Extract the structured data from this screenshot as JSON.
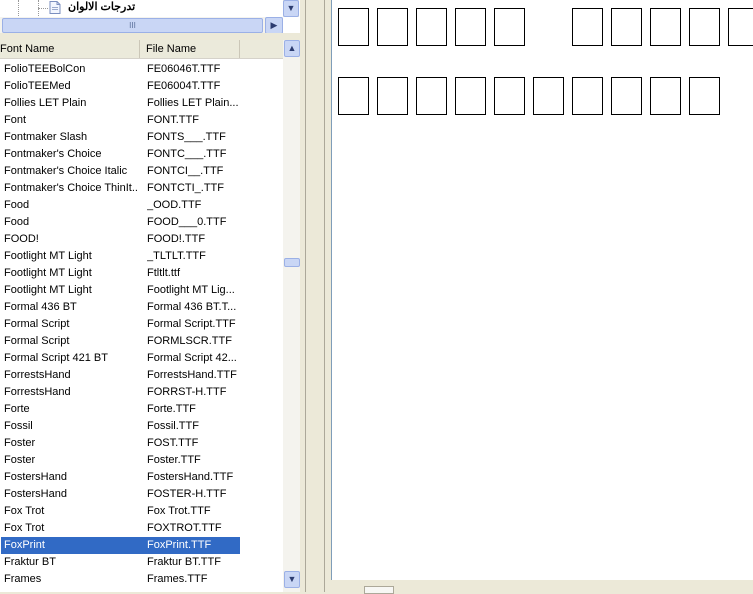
{
  "tree": {
    "label": "تدرجات الالوان"
  },
  "list": {
    "columns": {
      "font_name": "Font Name",
      "file_name": "File Name"
    },
    "rows": [
      [
        "FolioTEEBolCon",
        "FE06046T.TTF"
      ],
      [
        "FolioTEEMed",
        "FE06004T.TTF"
      ],
      [
        "Follies LET Plain",
        "Follies LET Plain..."
      ],
      [
        "Font",
        "FONT.TTF"
      ],
      [
        "Fontmaker Slash",
        "FONTS___.TTF"
      ],
      [
        "Fontmaker's Choice",
        "FONTC___.TTF"
      ],
      [
        "Fontmaker's Choice Italic",
        "FONTCI__.TTF"
      ],
      [
        "Fontmaker's Choice ThinIt...",
        "FONTCTI_.TTF"
      ],
      [
        "Food",
        "_OOD.TTF"
      ],
      [
        "Food",
        "FOOD___0.TTF"
      ],
      [
        "FOOD!",
        "FOOD!.TTF"
      ],
      [
        "Footlight MT Light",
        "_TLTLT.TTF"
      ],
      [
        "Footlight MT Light",
        "Ftltlt.ttf"
      ],
      [
        "Footlight MT Light",
        "Footlight MT Lig..."
      ],
      [
        "Formal 436 BT",
        "Formal 436 BT.T..."
      ],
      [
        "Formal Script",
        "Formal Script.TTF"
      ],
      [
        "Formal Script",
        "FORMLSCR.TTF"
      ],
      [
        "Formal Script 421 BT",
        "Formal Script 42..."
      ],
      [
        "ForrestsHand",
        "ForrestsHand.TTF"
      ],
      [
        "ForrestsHand",
        "FORRST-H.TTF"
      ],
      [
        "Forte",
        "Forte.TTF"
      ],
      [
        "Fossil",
        "Fossil.TTF"
      ],
      [
        "Foster",
        "FOST.TTF"
      ],
      [
        "Foster",
        "Foster.TTF"
      ],
      [
        "FostersHand",
        "FostersHand.TTF"
      ],
      [
        "FostersHand",
        "FOSTER-H.TTF"
      ],
      [
        "Fox Trot",
        "Fox Trot.TTF"
      ],
      [
        "Fox Trot",
        "FOXTROT.TTF"
      ],
      [
        "FoxPrint",
        "FoxPrint.TTF"
      ],
      [
        "Fraktur BT",
        "Fraktur BT.TTF"
      ],
      [
        "Frames",
        "Frames.TTF"
      ]
    ],
    "selected_index": 28
  },
  "scroll_icons": {
    "up": "▲",
    "down": "▼",
    "right": "▶",
    "grip": "III"
  }
}
